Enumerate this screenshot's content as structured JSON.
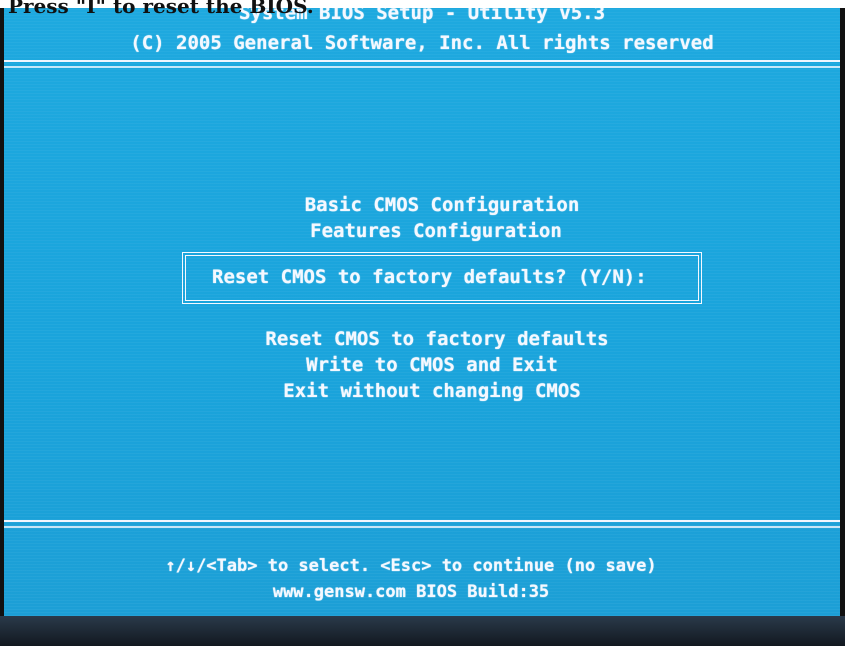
{
  "caption": "Press \"I\" to reset the BIOS.",
  "header": {
    "title": "System BIOS Setup - Utility v5.3",
    "copyright": "(C) 2005 General Software, Inc. All rights reserved"
  },
  "menu": {
    "upper_items": [
      {
        "label": "Basic CMOS Configuration"
      },
      {
        "label": "Features Configuration"
      }
    ],
    "lower_items": [
      {
        "label": "Reset CMOS to factory defaults"
      },
      {
        "label": "Write to CMOS and Exit"
      },
      {
        "label": "Exit without changing CMOS"
      }
    ]
  },
  "dialog": {
    "prompt": "Reset CMOS to factory defaults? (Y/N):"
  },
  "footer": {
    "help": "↑/↓/<Tab> to select.  <Esc> to continue (no save)",
    "build": "www.gensw.com BIOS Build:35"
  },
  "colors": {
    "screen_background": "#1ea9df",
    "text": "#f4f8ff"
  }
}
